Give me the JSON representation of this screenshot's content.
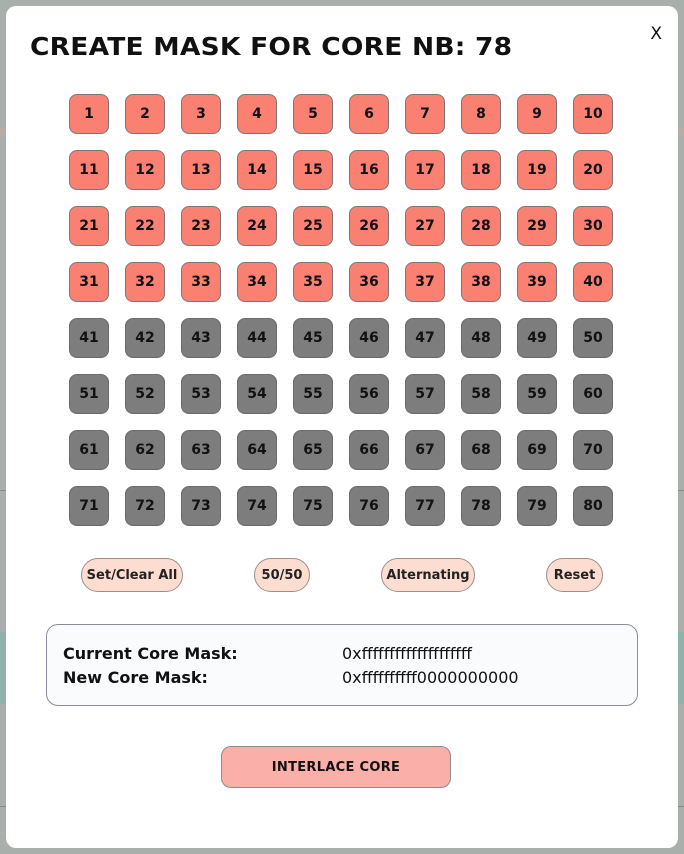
{
  "modal": {
    "title": "CREATE MASK FOR CORE NB: 78",
    "close_label": "X"
  },
  "cores": {
    "selected_count": 40,
    "labels": [
      "1",
      "2",
      "3",
      "4",
      "5",
      "6",
      "7",
      "8",
      "9",
      "10",
      "11",
      "12",
      "13",
      "14",
      "15",
      "16",
      "17",
      "18",
      "19",
      "20",
      "21",
      "22",
      "23",
      "24",
      "25",
      "26",
      "27",
      "28",
      "29",
      "30",
      "31",
      "32",
      "33",
      "34",
      "35",
      "36",
      "37",
      "38",
      "39",
      "40",
      "41",
      "42",
      "43",
      "44",
      "45",
      "46",
      "47",
      "48",
      "49",
      "50",
      "51",
      "52",
      "53",
      "54",
      "55",
      "56",
      "57",
      "58",
      "59",
      "60",
      "61",
      "62",
      "63",
      "64",
      "65",
      "66",
      "67",
      "68",
      "69",
      "70",
      "71",
      "72",
      "73",
      "74",
      "75",
      "76",
      "77",
      "78",
      "79",
      "80"
    ],
    "selected_color": "#fa8072",
    "unselected_color": "#7d7d7d"
  },
  "actions": {
    "set_clear_all": "Set/Clear All",
    "fifty_fifty": "50/50",
    "alternating": "Alternating",
    "reset": "Reset",
    "interlace": "INTERLACE CORE"
  },
  "mask": {
    "current_label": "Current Core Mask:",
    "current_value": "0xffffffffffffffffffff",
    "new_label": "New Core Mask:",
    "new_value": "0xffffffffff0000000000"
  }
}
